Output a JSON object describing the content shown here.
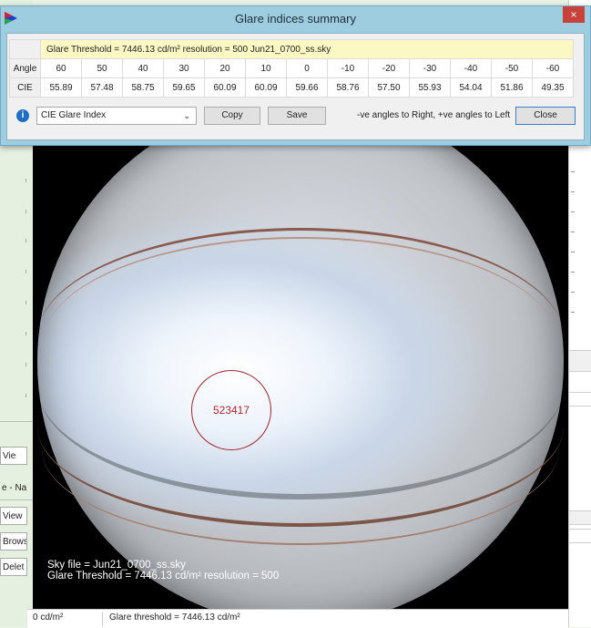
{
  "dialog": {
    "title": "Glare indices summary",
    "close_glyph": "×",
    "info_line": "Glare Threshold = 7446.13 cd/m²    resolution = 500    Jun21_0700_ss.sky",
    "row_angle_label": "Angle",
    "row_cie_label": "CIE",
    "angles": [
      "60",
      "50",
      "40",
      "30",
      "20",
      "10",
      "0",
      "-10",
      "-20",
      "-30",
      "-40",
      "-50",
      "-60"
    ],
    "cie_values": [
      "55.89",
      "57.48",
      "58.75",
      "59.65",
      "60.09",
      "60.09",
      "59.66",
      "58.76",
      "57.50",
      "55.93",
      "54.04",
      "51.86",
      "49.35"
    ],
    "info_icon_glyph": "i",
    "index_select_value": "CIE Glare Index",
    "copy_label": "Copy",
    "save_label": "Save",
    "hint": "-ve angles to Right, +ve angles to Left",
    "close_label": "Close"
  },
  "viewer": {
    "glare_value": "523417",
    "caption_line1": "Sky file = Jun21_0700_ss.sky",
    "caption_line2": "Glare Threshold = 7446.13 cd/m²  resolution = 500"
  },
  "status": {
    "left": "0 cd/m²",
    "threshold": "Glare threshold = 7446.13 cd/m²"
  },
  "side_panel": {
    "tab": "Vie",
    "name_label": "e - Na",
    "view_btn": "View",
    "browse_btn": "Brows",
    "delete_btn": "Delet"
  },
  "icons": {
    "app": "app-icon",
    "close": "close-icon",
    "info": "info-icon",
    "chevron": "chevron-down-icon"
  }
}
